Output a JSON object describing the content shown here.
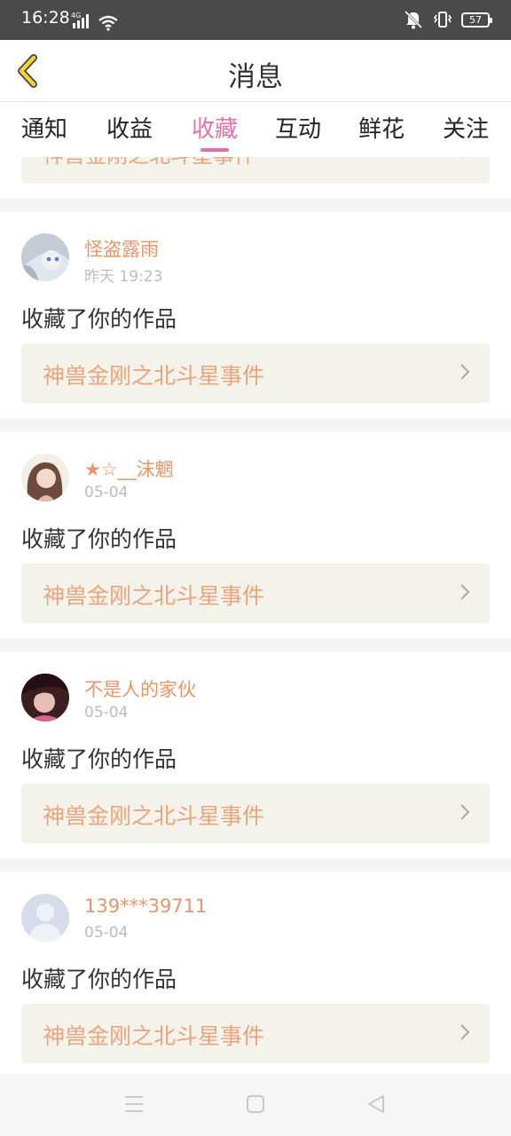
{
  "status_bar": {
    "time": "16:28",
    "network": "4G",
    "battery": "57"
  },
  "header": {
    "title": "消息"
  },
  "tabs": [
    {
      "label": "通知"
    },
    {
      "label": "收益"
    },
    {
      "label": "收藏",
      "active": true
    },
    {
      "label": "互动"
    },
    {
      "label": "鲜花"
    },
    {
      "label": "关注"
    }
  ],
  "partial_work_title": "神兽金刚之北斗星事件",
  "items": [
    {
      "user": "怪盗露雨",
      "time": "昨天 19:23",
      "action": "收藏了你的作品",
      "work": "神兽金刚之北斗星事件"
    },
    {
      "user": "★☆__沫魍",
      "time": "05-04",
      "action": "收藏了你的作品",
      "work": "神兽金刚之北斗星事件"
    },
    {
      "user": "不是人的家伙",
      "time": "05-04",
      "action": "收藏了你的作品",
      "work": "神兽金刚之北斗星事件"
    },
    {
      "user": "139***39711",
      "time": "05-04",
      "action": "收藏了你的作品",
      "work": "神兽金刚之北斗星事件"
    }
  ],
  "colors": {
    "accent": "#e66fa8",
    "username": "#e9956a",
    "work_title": "#e9a57c",
    "work_bg": "#f3f3ec",
    "status_bar": "#4a4a4a"
  }
}
